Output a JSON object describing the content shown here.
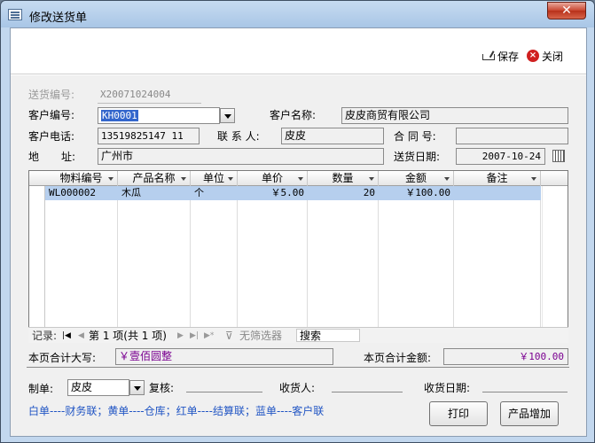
{
  "window": {
    "title": "修改送货单",
    "close_glyph": "✕"
  },
  "toolbar": {
    "save_label": "保存",
    "close_label": "关闭"
  },
  "form": {
    "delivery_no_label": "送货编号:",
    "delivery_no_value": "X20071024004",
    "customer_no_label": "客户编号:",
    "customer_no_value": "KH0001",
    "customer_name_label": "客户名称:",
    "customer_name_value": "皮皮商贸有限公司",
    "customer_phone_label": "客户电话:",
    "customer_phone_value": "13519825147 11",
    "contact_label": "联 系 人:",
    "contact_value": "皮皮",
    "contract_label": "合 同 号:",
    "contract_value": "",
    "address_label_a": "地",
    "address_label_b": "址:",
    "address_value": "广州市",
    "delivery_date_label": "送货日期:",
    "delivery_date_value": "2007-10-24"
  },
  "grid": {
    "columns": [
      "物料编号",
      "产品名称",
      "单位",
      "单价",
      "数量",
      "金额",
      "备注"
    ],
    "rows": [
      {
        "code": "WL000002",
        "name": "木瓜",
        "unit": "个",
        "price": "￥5.00",
        "qty": "20",
        "amount": "￥100.00",
        "note": ""
      }
    ]
  },
  "navigator": {
    "record_label": "记录:",
    "position": "第 1 项(共 1 项)",
    "filter_label": "无筛选器",
    "search_label": "搜索",
    "first_icon": "first-record-icon",
    "prev_icon": "prev-record-icon",
    "next_icon": "next-record-icon",
    "last_icon": "last-record-icon"
  },
  "totals": {
    "upper_label": "本页合计大写:",
    "upper_value": "￥壹佰圆整",
    "amount_label": "本页合计金额:",
    "amount_value": "￥100.00"
  },
  "footer": {
    "maker_label": "制单:",
    "maker_value": "皮皮",
    "reviewer_label": "复核:",
    "receiver_label": "收货人:",
    "receive_date_label": "收货日期:",
    "note": "白单----财务联；黄单----仓库；红单----结算联；蓝单----客户联",
    "print_button": "打印",
    "add_product_button": "产品增加"
  }
}
